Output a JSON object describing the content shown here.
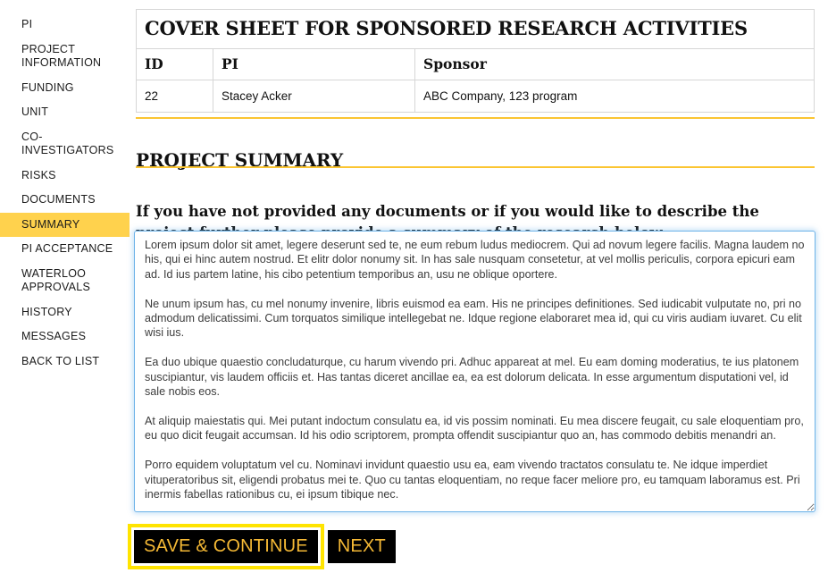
{
  "sidebar": {
    "items": [
      {
        "label": "PI",
        "active": false
      },
      {
        "label": "PROJECT INFORMATION",
        "active": false
      },
      {
        "label": "FUNDING",
        "active": false
      },
      {
        "label": "UNIT",
        "active": false
      },
      {
        "label": "CO-INVESTIGATORS",
        "active": false
      },
      {
        "label": "RISKS",
        "active": false
      },
      {
        "label": "DOCUMENTS",
        "active": false
      },
      {
        "label": "SUMMARY",
        "active": true
      },
      {
        "label": "PI ACCEPTANCE",
        "active": false
      },
      {
        "label": "WATERLOO APPROVALS",
        "active": false
      },
      {
        "label": "HISTORY",
        "active": false
      },
      {
        "label": "MESSAGES",
        "active": false
      },
      {
        "label": "BACK TO LIST",
        "active": false
      }
    ],
    "active_highlight_color": "#ffd24d"
  },
  "cover_sheet": {
    "title": "COVER SHEET FOR SPONSORED RESEARCH ACTIVITIES",
    "columns": [
      "ID",
      "PI",
      "Sponsor"
    ],
    "rows": [
      {
        "id": "22",
        "pi": "Stacey Acker",
        "sponsor": "ABC Company, 123 program"
      }
    ]
  },
  "section": {
    "heading": "PROJECT SUMMARY",
    "instructions": "If you have not provided any documents or if you would like to describe the project further please provide a summary of the research below.",
    "rule_color": "#fbc532"
  },
  "summary_field": {
    "placeholder": "",
    "value": "Lorem ipsum dolor sit amet, legere deserunt sed te, ne eum rebum ludus mediocrem. Qui ad novum legere facilis. Magna laudem no his, qui ei hinc autem nostrud. Et elitr dolor nonumy sit. In has sale nusquam consetetur, at vel mollis periculis, corpora epicuri eam ad. Id ius partem latine, his cibo petentium temporibus an, usu ne oblique oportere.\n\nNe unum ipsum has, cu mel nonumy invenire, libris euismod ea eam. His ne principes definitiones. Sed iudicabit vulputate no, pri no admodum delicatissimi. Cum torquatos similique intellegebat ne. Idque regione elaboraret mea id, qui cu viris audiam iuvaret. Cu elit wisi ius.\n\nEa duo ubique quaestio concludaturque, cu harum vivendo pri. Adhuc appareat at mel. Eu eam doming moderatius, te ius platonem suscipiantur, vis laudem officiis et. Has tantas diceret ancillae ea, ea est dolorum delicata. In esse argumentum disputationi vel, id sale nobis eos.\n\nAt aliquip maiestatis qui. Mei putant indoctum consulatu ea, id vis possim nominati. Eu mea discere feugait, cu sale eloquentiam pro, eu quo dicit feugait accumsan. Id his odio scriptorem, prompta offendit suscipiantur quo an, has commodo debitis menandri an.\n\nPorro equidem voluptatum vel cu. Nominavi invidunt quaestio usu ea, eam vivendo tractatos consulatu te. Ne idque imperdiet vituperatoribus sit, eligendi probatus mei te. Quo cu tantas eloquentiam, no reque facer meliore pro, eu tamquam laboramus est. Pri inermis fabellas rationibus cu, ei ipsum tibique nec.",
    "border_color": "#6db3e8",
    "focused": true
  },
  "buttons": {
    "save_continue": "SAVE & CONTINUE",
    "next": "NEXT",
    "text_color": "#f5b935",
    "background_color": "#000000",
    "focus_outline_color": "#ffe400"
  }
}
